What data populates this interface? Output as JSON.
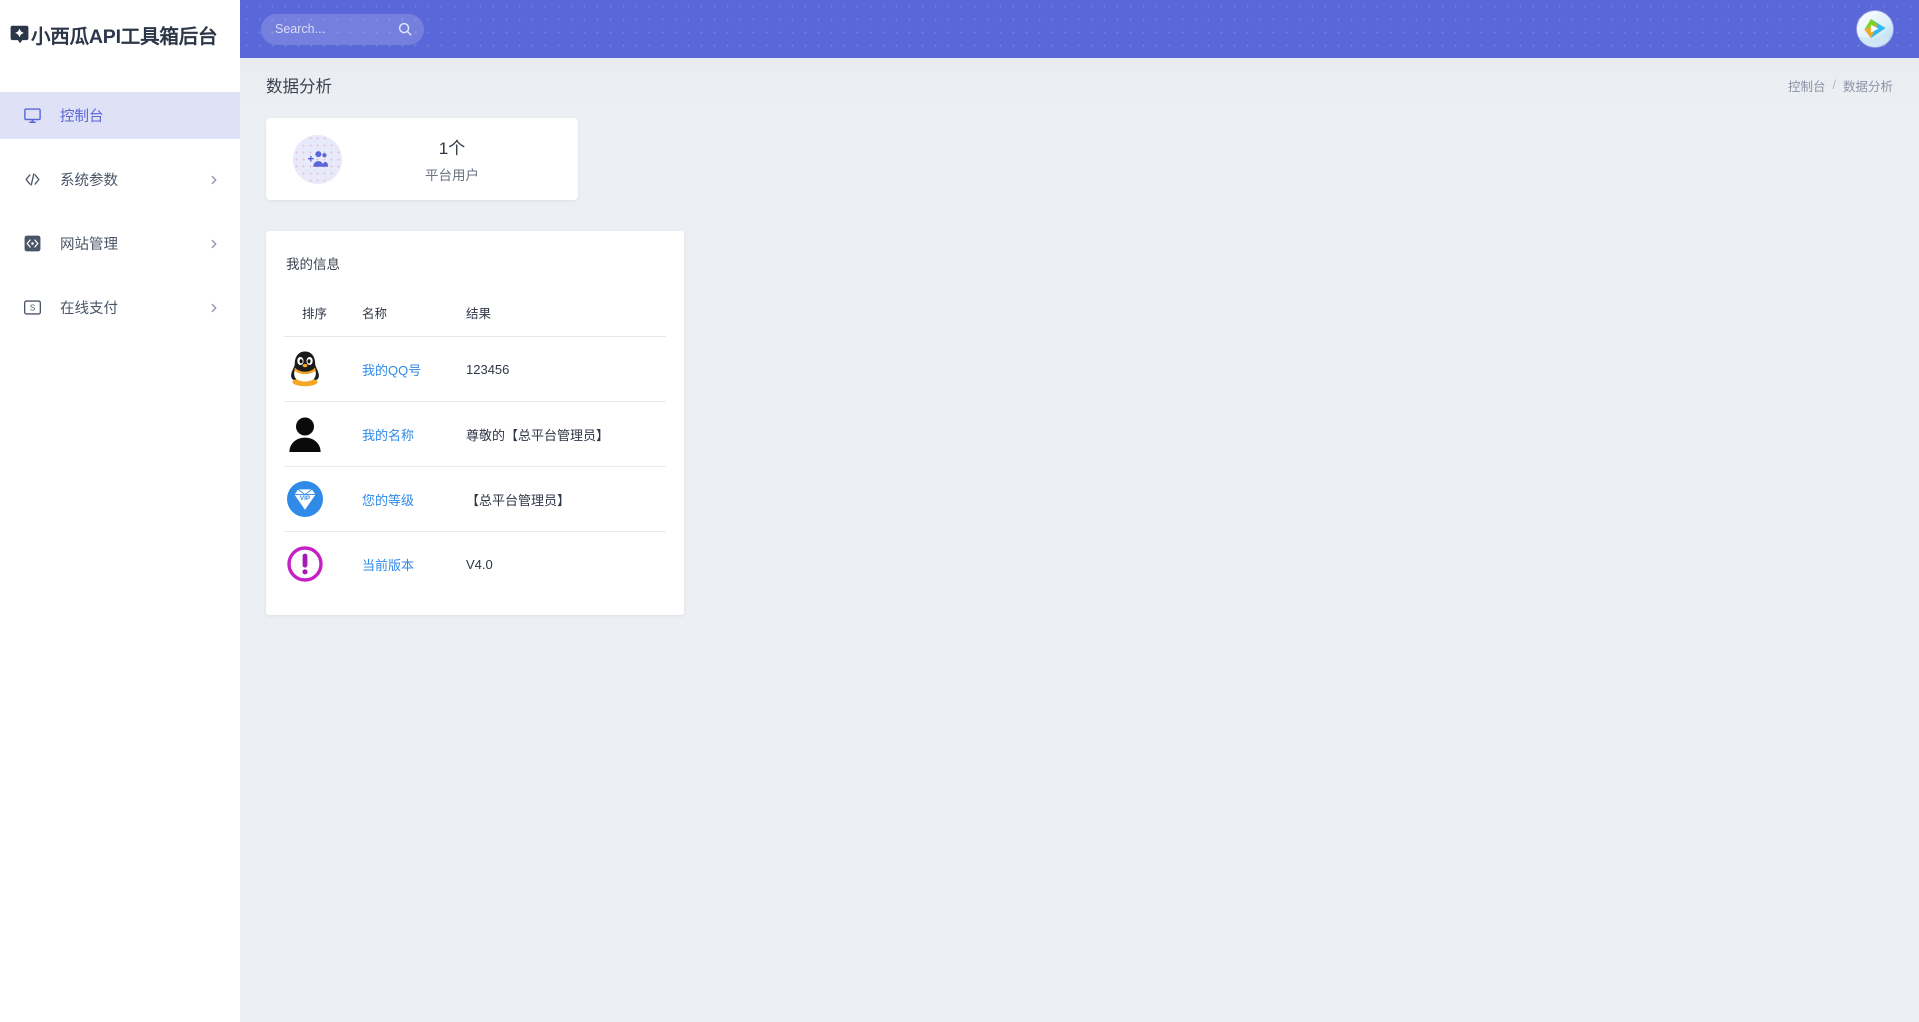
{
  "brand": {
    "logo_icon": "badge-star-icon",
    "title": "小西瓜API工具箱后台"
  },
  "sidebar": {
    "items": [
      {
        "label": "控制台",
        "icon": "monitor-icon",
        "active": true,
        "has_arrow": false
      },
      {
        "label": "系统参数",
        "icon": "code-brackets-icon",
        "active": false,
        "has_arrow": true
      },
      {
        "label": "网站管理",
        "icon": "code-box-icon",
        "active": false,
        "has_arrow": true
      },
      {
        "label": "在线支付",
        "icon": "banknote-icon",
        "active": false,
        "has_arrow": true
      }
    ]
  },
  "topbar": {
    "search": {
      "value": "",
      "placeholder": "Search...",
      "icon": "search-icon"
    },
    "avatar": {
      "name": "user-avatar",
      "icon": "play-logo-avatar"
    },
    "background_color": "#5a67d8"
  },
  "page": {
    "title": "数据分析",
    "breadcrumb": [
      {
        "label": "控制台",
        "current": false
      },
      {
        "label": "数据分析",
        "current": true
      }
    ],
    "breadcrumb_separator": "/"
  },
  "stat_card": {
    "icon": "add-users-icon",
    "value": "1个",
    "label": "平台用户",
    "icon_bg": "#e8e9fa",
    "icon_color": "#5a67d8"
  },
  "info_panel": {
    "title": "我的信息",
    "columns": [
      "排序",
      "名称",
      "结果"
    ],
    "rows": [
      {
        "icon": "qq-penguin-icon",
        "name": "我的QQ号",
        "result": "123456"
      },
      {
        "icon": "user-silhouette-icon",
        "name": "我的名称",
        "result": "尊敬的【总平台管理员】"
      },
      {
        "icon": "vip-diamond-icon",
        "name": "您的等级",
        "result": "【总平台管理员】"
      },
      {
        "icon": "alert-exclamation-icon",
        "name": "当前版本",
        "result": "V4.0"
      }
    ]
  },
  "colors": {
    "accent": "#5a67d8",
    "link": "#2f8ae8",
    "page_bg": "#eceff3",
    "panel_bg": "#ffffff",
    "vip_blue": "#2f8ae8",
    "alert_magenta": "#c621c6"
  }
}
